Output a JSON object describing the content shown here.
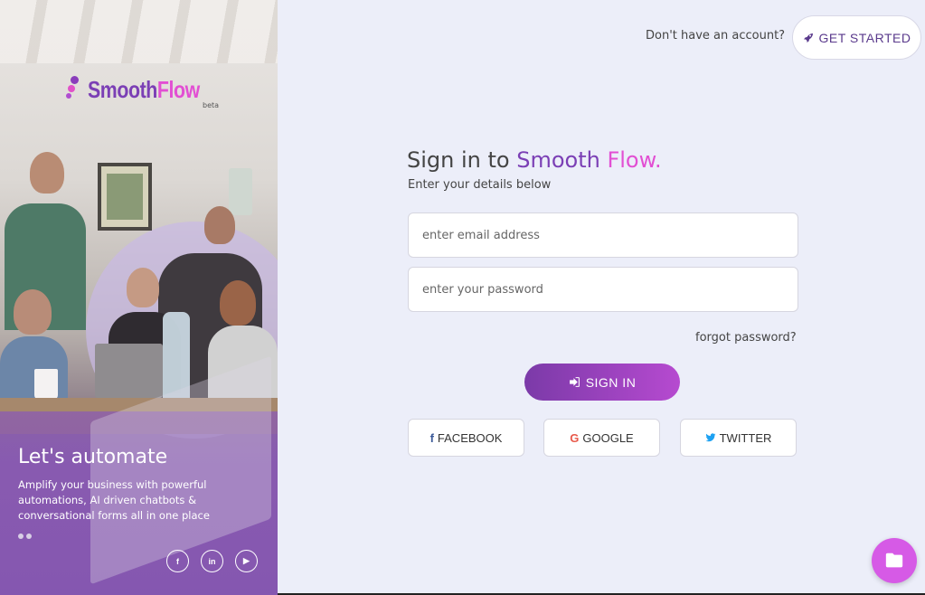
{
  "brand": {
    "name_part1": "Smooth",
    "name_part2": "Flow",
    "badge": "beta"
  },
  "hero": {
    "headline": "Let's automate",
    "description": "Amplify your business with powerful automations, AI driven chatbots & conversational forms all in one place",
    "carousel_dots": 2,
    "social_icons": [
      "facebook-icon",
      "linkedin-icon",
      "youtube-icon"
    ],
    "social_glyphs": {
      "facebook": "f",
      "linkedin": "in",
      "youtube": "▶"
    }
  },
  "header": {
    "prompt": "Don't have an account?",
    "get_started_label": "GET STARTED"
  },
  "form": {
    "title_prefix": "Sign in to ",
    "title_brand_1": "Smooth",
    "title_brand_2": " Flow.",
    "subtitle": "Enter your details below",
    "email_placeholder": "enter email address",
    "password_placeholder": "enter your password",
    "forgot_label": "forgot password?",
    "signin_label": "SIGN IN"
  },
  "social_login": {
    "facebook_label": "FACEBOOK",
    "google_label": "GOOGLE",
    "twitter_label": "TWITTER",
    "facebook_glyph": "f",
    "google_glyph": "G"
  },
  "colors": {
    "brand_purple": "#7b3fb5",
    "brand_pink": "#e24fd3",
    "background": "#eceef9",
    "fab": "#d65ae6"
  }
}
